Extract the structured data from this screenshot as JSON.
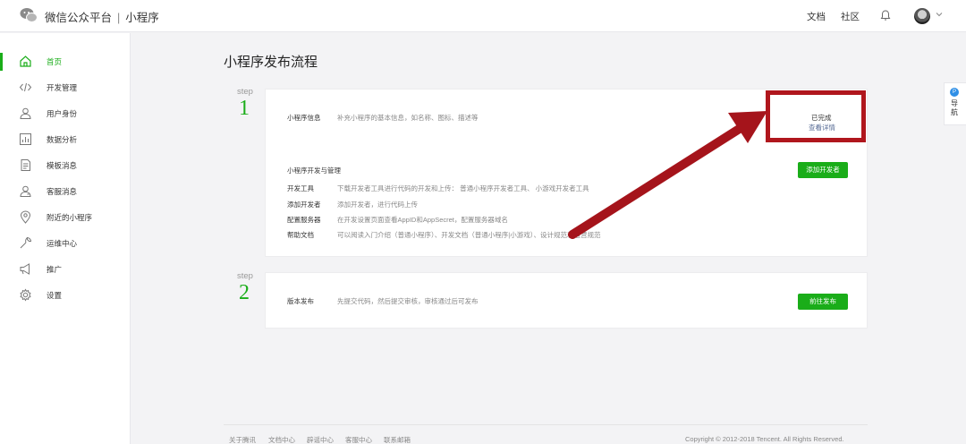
{
  "header": {
    "platform": "微信公众平台",
    "separator": "|",
    "product": "小程序",
    "links": [
      "文档",
      "社区"
    ]
  },
  "sidebar": {
    "items": [
      {
        "label": "首页",
        "icon": "home-icon",
        "active": true
      },
      {
        "label": "开发管理",
        "icon": "code-icon"
      },
      {
        "label": "用户身份",
        "icon": "user-icon"
      },
      {
        "label": "数据分析",
        "icon": "chart-icon"
      },
      {
        "label": "模板消息",
        "icon": "document-icon"
      },
      {
        "label": "客服消息",
        "icon": "customer-service-icon"
      },
      {
        "label": "附近的小程序",
        "icon": "location-icon"
      },
      {
        "label": "运维中心",
        "icon": "wrench-icon"
      },
      {
        "label": "推广",
        "icon": "megaphone-icon"
      },
      {
        "label": "设置",
        "icon": "gear-icon"
      }
    ]
  },
  "main": {
    "title": "小程序发布流程",
    "step_word": "step",
    "step1": {
      "number": "1",
      "info_label": "小程序信息",
      "info_desc": "补充小程序的基本信息，如名称、图标、描述等",
      "status": "已完成",
      "status_link": "查看详情",
      "dev_title": "小程序开发与管理",
      "add_dev_button": "添加开发者",
      "rows": [
        {
          "label": "开发工具",
          "desc": "下载开发者工具进行代码的开发和上传： 普通小程序开发者工具、 小游戏开发者工具"
        },
        {
          "label": "添加开发者",
          "desc": "添加开发者，进行代码上传"
        },
        {
          "label": "配置服务器",
          "desc": "在开发设置页面查看AppID和AppSecret，配置服务器域名"
        },
        {
          "label": "帮助文档",
          "desc": "可以阅读入门介绍（普通小程序）、开发文档（普通小程序|小游戏）、设计规范和运营规范"
        }
      ]
    },
    "step2": {
      "number": "2",
      "label": "版本发布",
      "desc": "先提交代码，然后提交审核，审核通过后可发布",
      "button": "前往发布"
    }
  },
  "guide": {
    "badge": "P",
    "label": "导航"
  },
  "footer": {
    "links": [
      "关于腾讯",
      "文档中心",
      "辟谣中心",
      "客服中心",
      "联系邮箱"
    ],
    "copyright": "Copyright © 2012-2018 Tencent. All Rights Reserved."
  },
  "colors": {
    "accent": "#1aad19",
    "highlight": "#b0161d",
    "link": "#576b95"
  }
}
